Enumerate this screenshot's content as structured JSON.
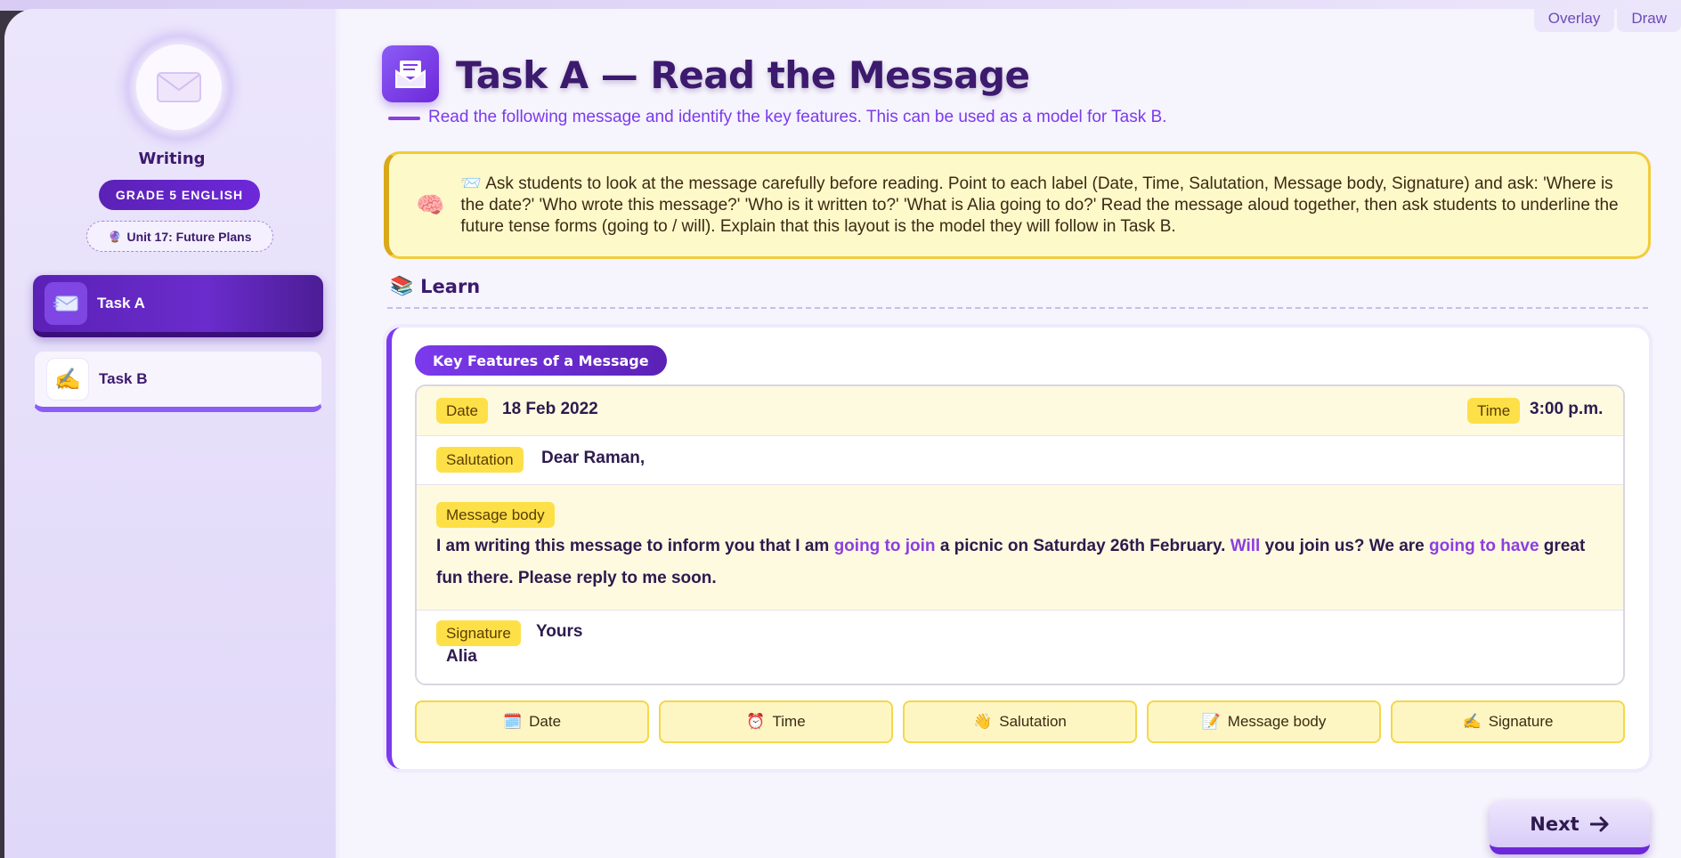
{
  "window": {
    "tabs": [
      "Overlay",
      "Draw"
    ]
  },
  "sidebar": {
    "avatar_icon": "envelope-icon",
    "title": "Writing",
    "grade": "GRADE 5 ENGLISH",
    "unit": "Unit 17: Future Plans",
    "tasks": [
      {
        "label": "Task A",
        "icon": "envelope-card-icon",
        "active": true
      },
      {
        "label": "Task B",
        "icon": "writing-hand-icon",
        "active": false
      }
    ]
  },
  "main": {
    "title": "Task A — Read the Message",
    "title_icon": "open-envelope-icon",
    "subtitle": "Read the following message and identify the key features. This can be used as a model for Task B.",
    "teacher_note": "📨 Ask students to look at the message carefully before reading. Point to each label (Date, Time, Salutation, Message body, Signature) and ask: 'Where is the date?' 'Who wrote this message?' 'Who is it written to?' 'What is Alia going to do?' Read the message aloud together, then ask students to underline the future tense forms (going to / will). Explain that this layout is the model they will follow in Task B.",
    "learn_heading": "Learn",
    "card_label": "Key Features of a Message",
    "message": {
      "date_label": "Date",
      "date_value": "18 Feb 2022",
      "time_label": "Time",
      "time_value": "3:00 p.m.",
      "salutation_label": "Salutation",
      "salutation_value": "Dear Raman,",
      "body_label": "Message body",
      "body_parts": [
        "I am writing this message to inform you that I am ",
        "going to join",
        " a picnic on Saturday 26th February. ",
        "Will",
        " you join us? We are ",
        "going to have",
        " great fun there. Please reply to me soon."
      ],
      "signature_label": "Signature",
      "signature_line1": "Yours",
      "signature_line2": "Alia"
    },
    "feature_buttons": [
      {
        "icon": "🗓️",
        "label": "Date"
      },
      {
        "icon": "⏰",
        "label": "Time"
      },
      {
        "icon": "👋",
        "label": "Salutation"
      },
      {
        "icon": "📝",
        "label": "Message body"
      },
      {
        "icon": "✍️",
        "label": "Signature"
      }
    ],
    "next_label": "Next"
  },
  "colors": {
    "accent_purple": "#6d28d9",
    "highlight_purple": "#8b3fe0",
    "tag_yellow": "#fde047",
    "note_bg": "#fef9c9"
  }
}
